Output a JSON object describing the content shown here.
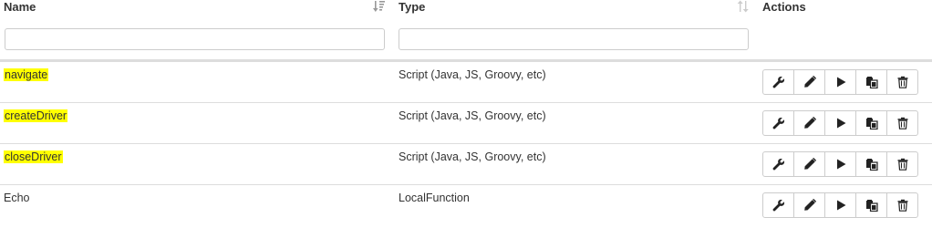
{
  "columns": {
    "name": "Name",
    "type": "Type",
    "actions": "Actions"
  },
  "filters": {
    "name_value": "",
    "type_value": ""
  },
  "rows": [
    {
      "name": "navigate",
      "type": "Script (Java, JS, Groovy, etc)",
      "highlighted": true
    },
    {
      "name": "createDriver",
      "type": "Script (Java, JS, Groovy, etc)",
      "highlighted": true
    },
    {
      "name": "closeDriver",
      "type": "Script (Java, JS, Groovy, etc)",
      "highlighted": true
    },
    {
      "name": "Echo",
      "type": "LocalFunction",
      "highlighted": false
    }
  ],
  "action_icons": [
    "wrench-icon",
    "pencil-icon",
    "play-icon",
    "copy-icon",
    "trash-icon"
  ],
  "colors": {
    "highlight": "#ffff00",
    "border": "#dddddd",
    "text": "#333333"
  }
}
